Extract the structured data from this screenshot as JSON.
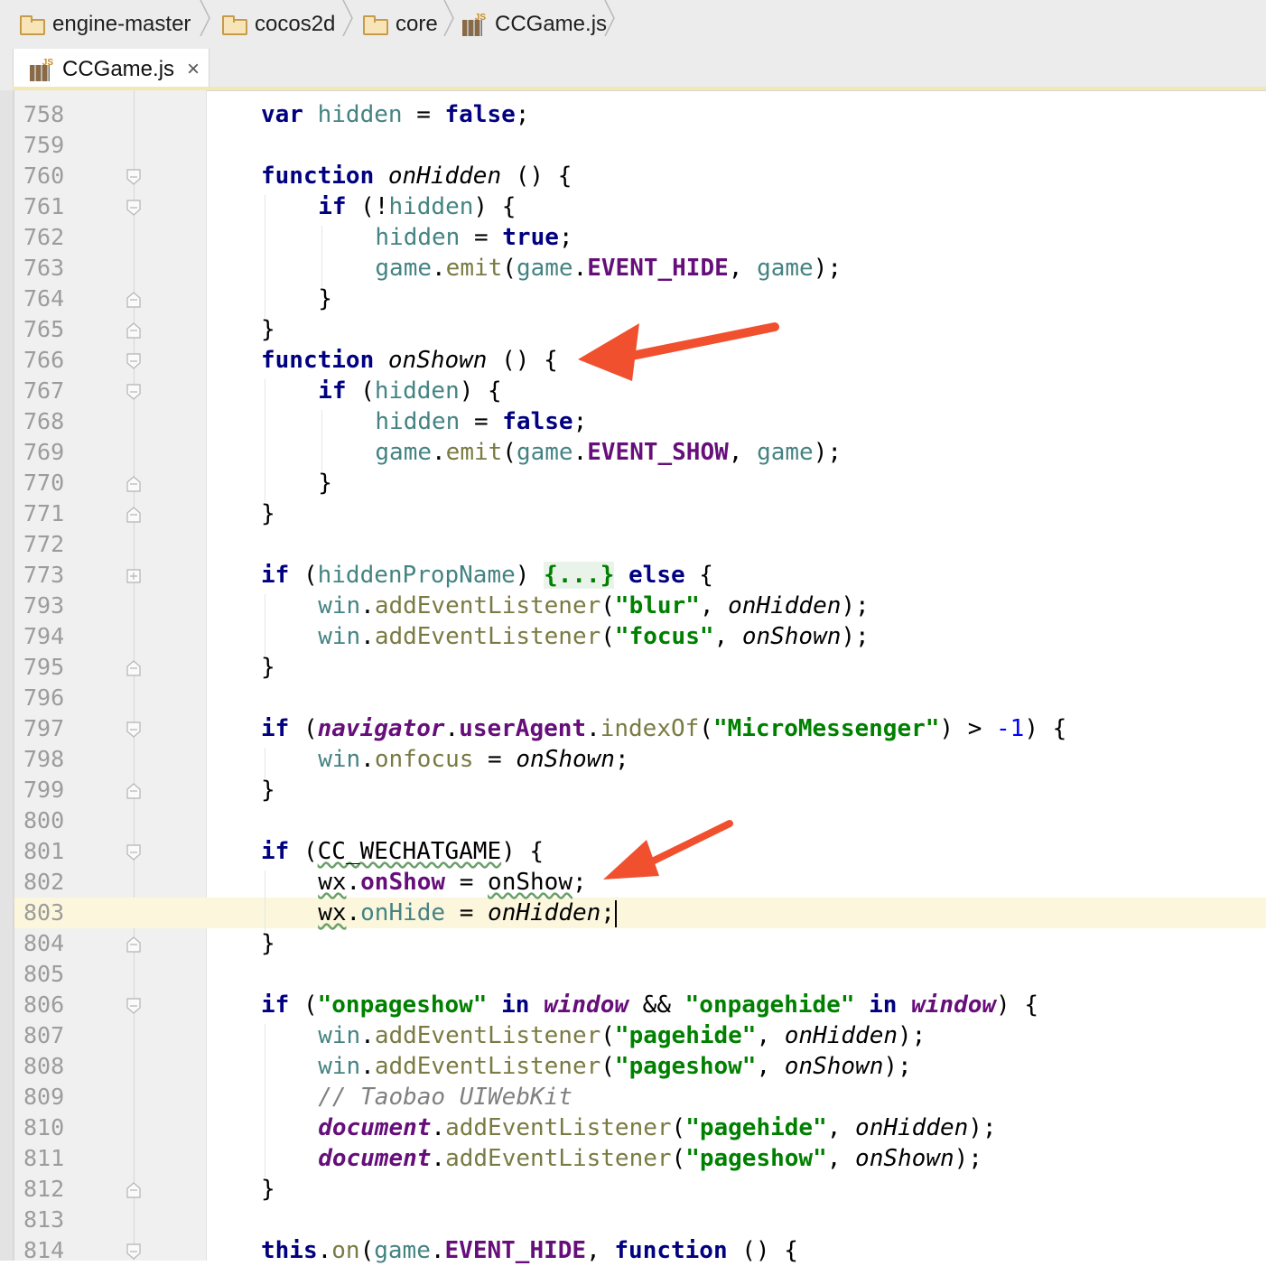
{
  "breadcrumb": [
    {
      "label": "engine-master",
      "icon": "folder-icon"
    },
    {
      "label": "cocos2d",
      "icon": "folder-icon"
    },
    {
      "label": "core",
      "icon": "folder-icon"
    },
    {
      "label": "CCGame.js",
      "icon": "js-file-icon"
    }
  ],
  "tab": {
    "label": "CCGame.js",
    "close": "×",
    "icon": "js-file-icon"
  },
  "line_numbers": [
    "758",
    "759",
    "760",
    "761",
    "762",
    "763",
    "764",
    "765",
    "766",
    "767",
    "768",
    "769",
    "770",
    "771",
    "772",
    "773",
    "793",
    "794",
    "795",
    "796",
    "797",
    "798",
    "799",
    "800",
    "801",
    "802",
    "803",
    "804",
    "805",
    "806",
    "807",
    "808",
    "809",
    "810",
    "811",
    "812",
    "813",
    "814"
  ],
  "code": {
    "l758": [
      "var",
      " ",
      "hidden",
      " = ",
      "false",
      ";"
    ],
    "l760": [
      "function",
      " ",
      "onHidden",
      " () {"
    ],
    "l761": [
      "if",
      " (!",
      "hidden",
      ") {"
    ],
    "l762": [
      "hidden",
      " = ",
      "true",
      ";"
    ],
    "l763": [
      "game",
      ".",
      "emit",
      "(",
      "game",
      ".",
      "EVENT_HIDE",
      ", ",
      "game",
      ");"
    ],
    "l764": [
      "}"
    ],
    "l765": [
      "}"
    ],
    "l766": [
      "function",
      " ",
      "onShown",
      " () {"
    ],
    "l767": [
      "if",
      " (",
      "hidden",
      ") {"
    ],
    "l768": [
      "hidden",
      " = ",
      "false",
      ";"
    ],
    "l769": [
      "game",
      ".",
      "emit",
      "(",
      "game",
      ".",
      "EVENT_SHOW",
      ", ",
      "game",
      ");"
    ],
    "l770": [
      "}"
    ],
    "l771": [
      "}"
    ],
    "l773": [
      "if",
      " (",
      "hiddenPropName",
      ") ",
      "{...}",
      " ",
      "else",
      " {"
    ],
    "l793": [
      "win",
      ".",
      "addEventListener",
      "(",
      "\"blur\"",
      ", ",
      "onHidden",
      ");"
    ],
    "l794": [
      "win",
      ".",
      "addEventListener",
      "(",
      "\"focus\"",
      ", ",
      "onShown",
      ");"
    ],
    "l795": [
      "}"
    ],
    "l797": [
      "if",
      " (",
      "navigator",
      ".",
      "userAgent",
      ".",
      "indexOf",
      "(",
      "\"MicroMessenger\"",
      ") > ",
      "-1",
      ") {"
    ],
    "l798": [
      "win",
      ".",
      "onfocus",
      " = ",
      "onShown",
      ";"
    ],
    "l799": [
      "}"
    ],
    "l801": [
      "if",
      " (",
      "CC_WECHATGAME",
      ") {"
    ],
    "l802": [
      "wx",
      ".",
      "onShow",
      " = ",
      "onShow",
      ";"
    ],
    "l803": [
      "wx",
      ".",
      "onHide",
      " = ",
      "onHidden",
      ";"
    ],
    "l804": [
      "}"
    ],
    "l806": [
      "if",
      " (",
      "\"onpageshow\"",
      " ",
      "in",
      " ",
      "window",
      " && ",
      "\"onpagehide\"",
      " ",
      "in",
      " ",
      "window",
      ") {"
    ],
    "l807": [
      "win",
      ".",
      "addEventListener",
      "(",
      "\"pagehide\"",
      ", ",
      "onHidden",
      ");"
    ],
    "l808": [
      "win",
      ".",
      "addEventListener",
      "(",
      "\"pageshow\"",
      ", ",
      "onShown",
      ");"
    ],
    "l809": [
      "// Taobao UIWebKit"
    ],
    "l810": [
      "document",
      ".",
      "addEventListener",
      "(",
      "\"pagehide\"",
      ", ",
      "onHidden",
      ");"
    ],
    "l811": [
      "document",
      ".",
      "addEventListener",
      "(",
      "\"pageshow\"",
      ", ",
      "onShown",
      ");"
    ],
    "l812": [
      "}"
    ],
    "l814": [
      "this",
      ".",
      "on",
      "(",
      "game",
      ".",
      "EVENT_HIDE",
      ", ",
      "function",
      " () {"
    ]
  },
  "colors": {
    "arrow": "#f0502e",
    "keyword": "#000080",
    "string": "#008000",
    "current_line": "#fcf7dc"
  }
}
